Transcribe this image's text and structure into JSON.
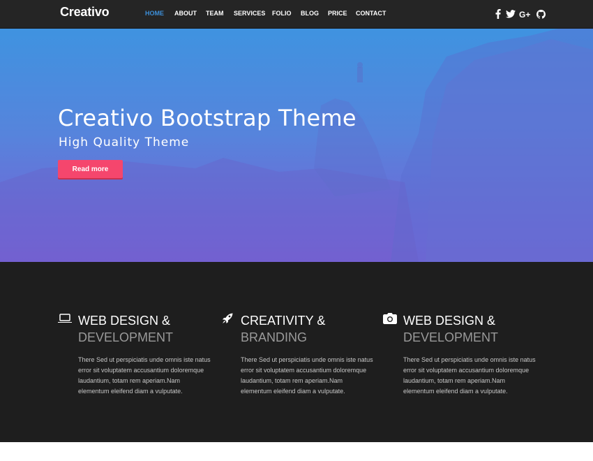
{
  "brand": "Creativo",
  "nav": {
    "items": [
      {
        "label": "HOME",
        "active": true
      },
      {
        "label": "ABOUT"
      },
      {
        "label": "TEAM"
      },
      {
        "label": "SERVICES"
      },
      {
        "label": "FOLIO"
      },
      {
        "label": "BLOG"
      },
      {
        "label": "PRICE"
      },
      {
        "label": "CONTACT"
      }
    ],
    "social": [
      "facebook-icon",
      "twitter-icon",
      "google-plus-icon",
      "github-icon"
    ]
  },
  "hero": {
    "title": "Creativo Bootstrap Theme",
    "subtitle": "High Quality Theme",
    "button_label": "Read more"
  },
  "features": [
    {
      "icon": "laptop-icon",
      "title": "WEB DESIGN &",
      "subtitle": "DEVELOPMENT",
      "text": "There Sed ut perspiciatis unde omnis iste natus error sit voluptatem accusantium doloremque laudantium, totam rem aperiam.Nam elementum eleifend diam a vulputate."
    },
    {
      "icon": "rocket-icon",
      "title": "CREATIVITY &",
      "subtitle": "BRANDING",
      "text": "There Sed ut perspiciatis unde omnis iste natus error sit voluptatem accusantium doloremque laudantium, totam rem aperiam.Nam elementum eleifend diam a vulputate."
    },
    {
      "icon": "camera-icon",
      "title": "WEB DESIGN &",
      "subtitle": "DEVELOPMENT",
      "text": "There Sed ut perspiciatis unde omnis iste natus error sit voluptatem accusantium doloremque laudantium, totam rem aperiam.Nam elementum eleifend diam a vulputate."
    }
  ],
  "colors": {
    "nav_bg": "#252525",
    "nav_active": "#3d8fd8",
    "hero_top": "#3f93e0",
    "hero_bottom": "#7a60d6",
    "button": "#f5466d",
    "features_bg": "#1e1e1e"
  }
}
